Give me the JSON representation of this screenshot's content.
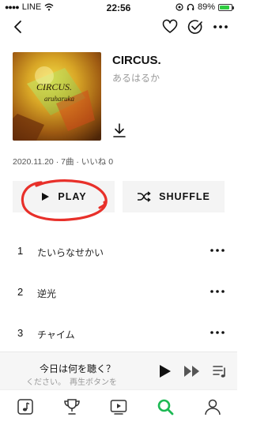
{
  "status_bar": {
    "carrier": "LINE",
    "time": "22:56",
    "battery_pct": "89%"
  },
  "album": {
    "title": "CIRCUS.",
    "artist": "あるはるか",
    "meta": "2020.11.20 · 7曲 · いいね 0",
    "cover_text_1": "CIRCUS.",
    "cover_text_2": "aruharuka"
  },
  "actions": {
    "play_label": "PLAY",
    "shuffle_label": "SHUFFLE"
  },
  "tracks": [
    {
      "num": "1",
      "title": "たいらなせかい"
    },
    {
      "num": "2",
      "title": "逆光"
    },
    {
      "num": "3",
      "title": "チャイム"
    }
  ],
  "mini_player": {
    "title": "今日は何を聴く？",
    "subtitle": "ください。　再生ボタンを"
  },
  "colors": {
    "accent": "#1db954",
    "annotation": "#e8302a",
    "button_bg": "#f4f4f4"
  },
  "tabs": [
    {
      "icon": "music-note-icon"
    },
    {
      "icon": "trophy-icon"
    },
    {
      "icon": "video-icon"
    },
    {
      "icon": "search-icon",
      "active": true
    },
    {
      "icon": "profile-icon"
    }
  ]
}
